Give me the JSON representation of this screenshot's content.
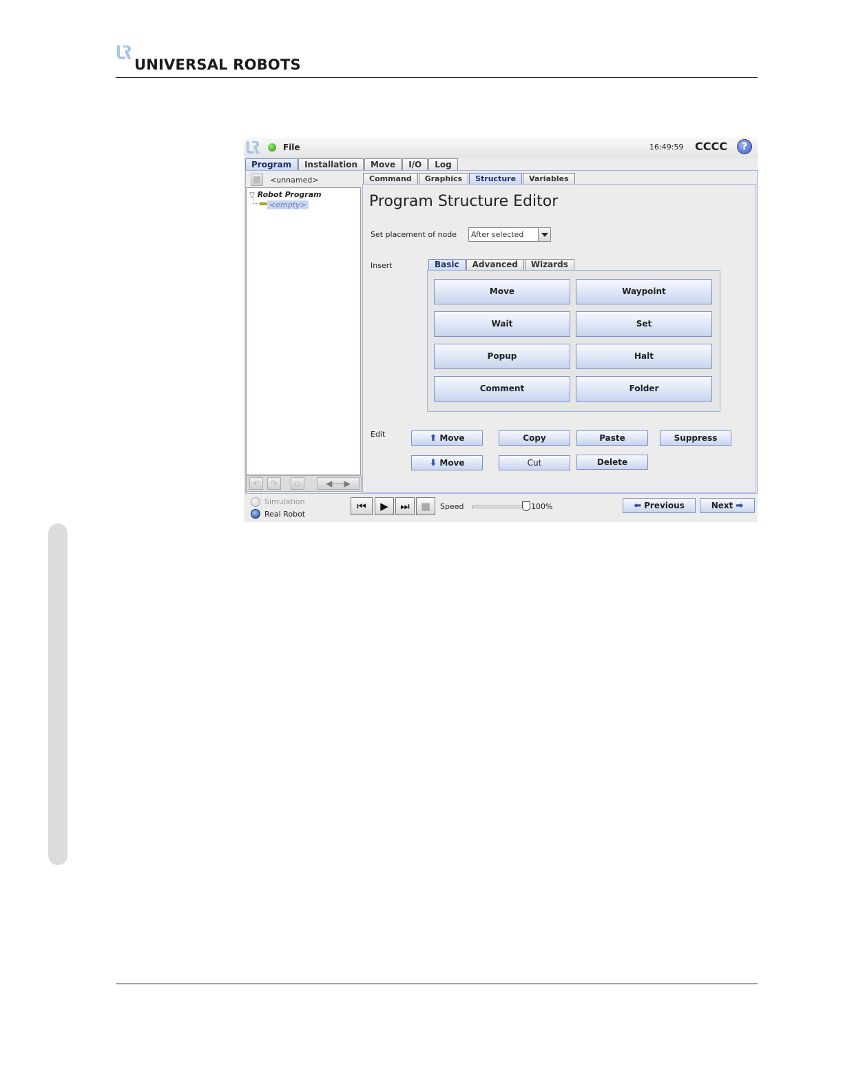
{
  "document": {
    "brand": "UNIVERSAL ROBOTS"
  },
  "titlebar": {
    "file_label": "File",
    "clock": "16:49:59",
    "robot_name": "CCCC",
    "help_symbol": "?"
  },
  "main_tabs": [
    "Program",
    "Installation",
    "Move",
    "I/O",
    "Log"
  ],
  "program_panel": {
    "program_name": "<unnamed>",
    "tree_root": "Robot Program",
    "tree_child": "<empty>"
  },
  "sub_tabs": [
    "Command",
    "Graphics",
    "Structure",
    "Variables"
  ],
  "editor": {
    "title": "Program Structure Editor",
    "placement_label": "Set placement of node",
    "placement_value": "After selected",
    "insert_label": "Insert",
    "insert_tabs": [
      "Basic",
      "Advanced",
      "Wizards"
    ],
    "insert_buttons": [
      "Move",
      "Waypoint",
      "Wait",
      "Set",
      "Popup",
      "Halt",
      "Comment",
      "Folder"
    ],
    "edit_label": "Edit",
    "edit_buttons": {
      "move_up": "Move",
      "move_down": "Move",
      "copy": "Copy",
      "cut": "Cut",
      "paste": "Paste",
      "delete": "Delete",
      "suppress": "Suppress"
    }
  },
  "bottom": {
    "simulation_label": "Simulation",
    "real_robot_label": "Real Robot",
    "speed_label": "Speed",
    "speed_value": "100%",
    "speed_fraction": 1.0,
    "previous_label": "Previous",
    "next_label": "Next"
  },
  "colors": {
    "accent": "#c9d7f1",
    "status_ok": "#1f8a10",
    "button_border": "#7b90c4"
  }
}
